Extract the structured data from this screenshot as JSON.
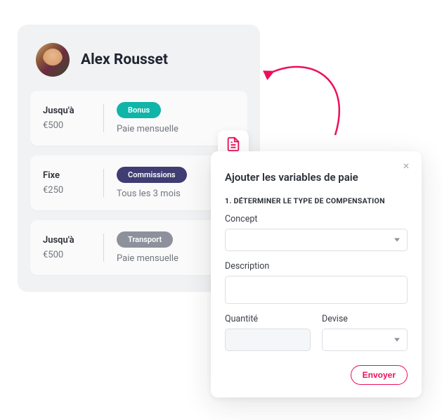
{
  "profile": {
    "name": "Alex Rousset"
  },
  "payItems": [
    {
      "label": "Jusqu'à",
      "amount": "€500",
      "tag": "Bonus",
      "tagColor": "teal",
      "frequency": "Paie mensuelle"
    },
    {
      "label": "Fixe",
      "amount": "€250",
      "tag": "Commissions",
      "tagColor": "indigo",
      "frequency": "Tous les 3 mois"
    },
    {
      "label": "Jusqu'à",
      "amount": "€500",
      "tag": "Transport",
      "tagColor": "grey",
      "frequency": "Paie mensuelle"
    }
  ],
  "modal": {
    "title": "Ajouter les variables de paie",
    "sectionHead": "1. DÉTERMINER LE TYPE DE COMPENSATION",
    "labels": {
      "concept": "Concept",
      "description": "Description",
      "quantity": "Quantité",
      "currency": "Devise"
    },
    "values": {
      "concept": "",
      "description": "",
      "quantity": "",
      "currency": ""
    },
    "submit": "Envoyer"
  },
  "icons": {
    "document": "document-list-icon",
    "close": "×"
  },
  "colors": {
    "accent": "#ed0f59",
    "teal": "#0fb5a8",
    "indigo": "#3f3d72",
    "grey": "#8d919b"
  }
}
